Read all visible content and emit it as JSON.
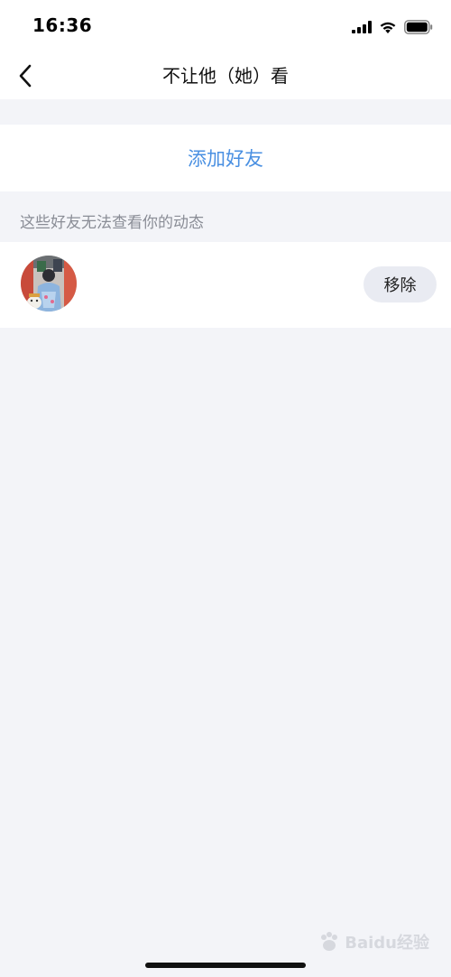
{
  "status_bar": {
    "time": "16:36",
    "icons": [
      "signal-icon",
      "wifi-icon",
      "battery-icon"
    ]
  },
  "nav": {
    "back_icon": "chevron-left-icon",
    "title": "不让他（她）看"
  },
  "add_friend": {
    "label": "添加好友"
  },
  "section": {
    "hint": "这些好友无法查看你的动态"
  },
  "friends": [
    {
      "avatar": "avatar-photo",
      "remove_label": "移除"
    }
  ],
  "watermark": {
    "text": "Baidu经验"
  },
  "colors": {
    "accent": "#4A90E2",
    "background": "#F3F4F8",
    "remove_button_bg": "#E9EBF2"
  }
}
